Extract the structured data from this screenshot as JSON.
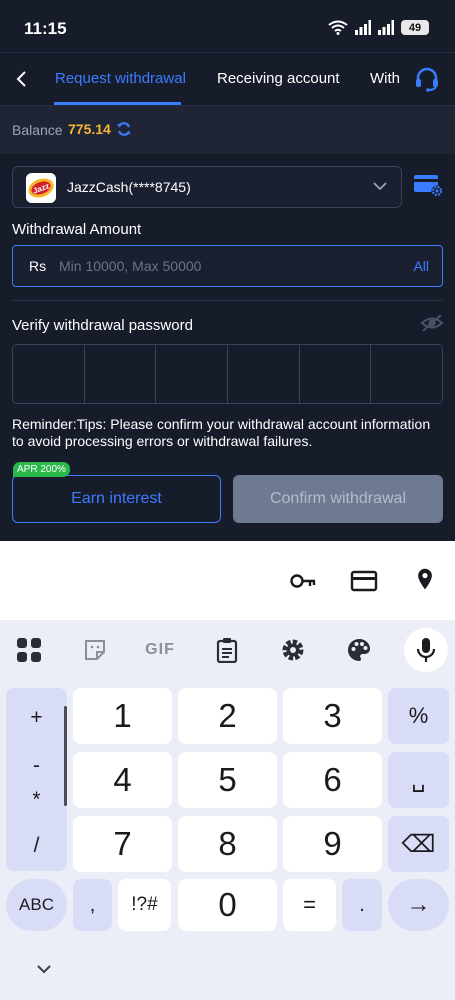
{
  "status_bar": {
    "time": "11:15",
    "battery": "49"
  },
  "nav": {
    "tabs": [
      {
        "label": "Request withdrawal",
        "active": true
      },
      {
        "label": "Receiving account",
        "active": false
      },
      {
        "label": "With",
        "active": false
      }
    ]
  },
  "balance": {
    "label": "Balance",
    "value": "775.14"
  },
  "account": {
    "name": "JazzCash(****8745)",
    "logo_text": "Jazz"
  },
  "amount": {
    "label": "Withdrawal Amount",
    "currency": "Rs",
    "placeholder": "Min 10000, Max 50000",
    "all_label": "All"
  },
  "password": {
    "label": "Verify withdrawal password",
    "digits": 6
  },
  "reminder": "Reminder:Tips: Please confirm your withdrawal account information to avoid processing errors or withdrawal failures.",
  "buttons": {
    "apr_badge": "APR 200%",
    "earn": "Earn interest",
    "confirm": "Confirm withdrawal"
  },
  "keyboard": {
    "toolbar_gif": "GIF",
    "symbols": [
      "+",
      "-",
      "*",
      "/"
    ],
    "keys": [
      "1",
      "2",
      "3",
      "%",
      "4",
      "5",
      "6",
      "␣",
      "7",
      "8",
      "9",
      "⌫",
      ",",
      "!?#",
      "0",
      "=",
      ".",
      "→"
    ],
    "abc": "ABC"
  },
  "colors": {
    "accent": "#3b7cff",
    "balance": "#f5b63a",
    "background": "#171c2b"
  }
}
